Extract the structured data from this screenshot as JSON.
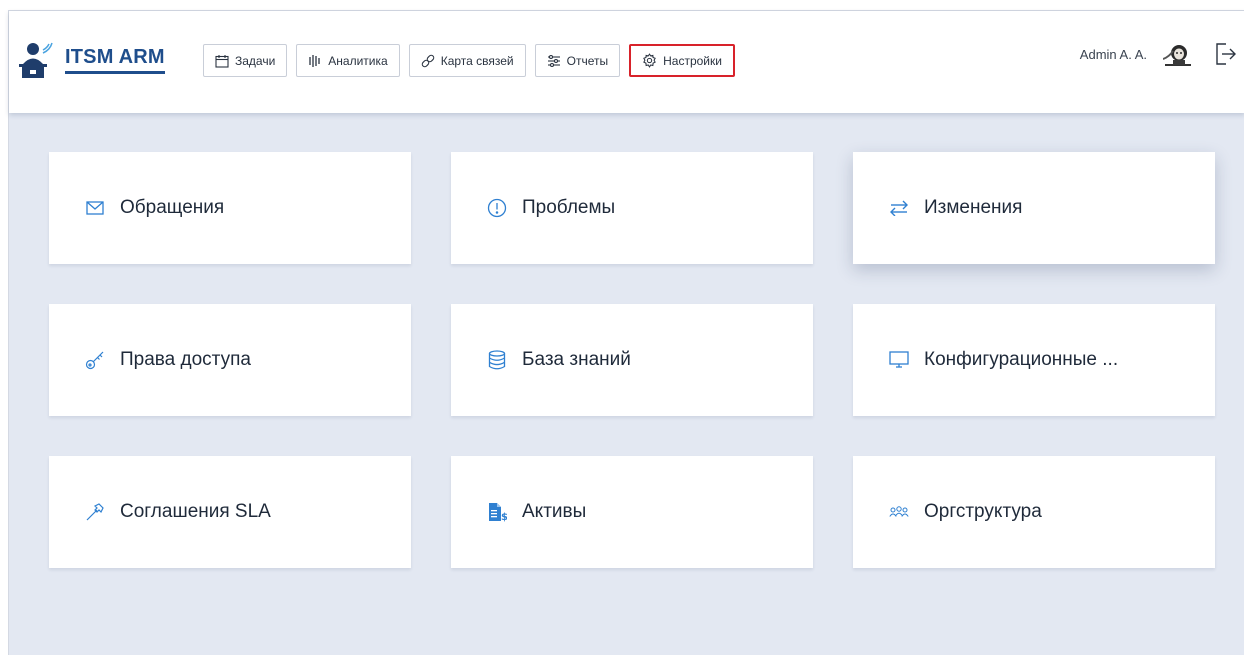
{
  "app": {
    "logo_text": "ITSM ARM"
  },
  "nav": [
    {
      "label": "Задачи",
      "icon": "calendar-icon"
    },
    {
      "label": "Аналитика",
      "icon": "bars-icon"
    },
    {
      "label": "Карта связей",
      "icon": "link-icon"
    },
    {
      "label": "Отчеты",
      "icon": "sliders-icon"
    },
    {
      "label": "Настройки",
      "icon": "gear-icon",
      "active": true
    }
  ],
  "user": {
    "name": "Admin A. A."
  },
  "tiles": [
    {
      "label": "Обращения",
      "icon": "mail-icon"
    },
    {
      "label": "Проблемы",
      "icon": "alert-circle-icon"
    },
    {
      "label": "Изменения",
      "icon": "swap-icon"
    },
    {
      "label": "Права доступа",
      "icon": "key-icon"
    },
    {
      "label": "База знаний",
      "icon": "database-icon"
    },
    {
      "label": "Конфигурационные ...",
      "icon": "monitor-icon"
    },
    {
      "label": "Соглашения SLA",
      "icon": "hammer-icon"
    },
    {
      "label": "Активы",
      "icon": "asset-document-icon"
    },
    {
      "label": "Оргструктура",
      "icon": "people-icon"
    }
  ],
  "colors": {
    "accent": "#2f80d1",
    "brand": "#1f4e8c",
    "active_border": "#d8222a",
    "background": "#e3e8f2"
  }
}
